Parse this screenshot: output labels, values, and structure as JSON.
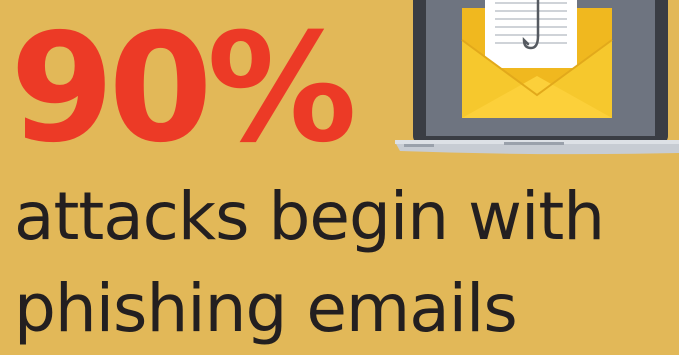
{
  "headline": {
    "stat": "90%",
    "line1": "attacks begin with",
    "line2": "phishing emails"
  },
  "illustration": {
    "icon": "laptop-phishing-email-icon",
    "parts": [
      "laptop-icon",
      "envelope-icon",
      "fishing-hook-icon"
    ]
  },
  "colors": {
    "background": "#e2b858",
    "stat": "#ec3a26",
    "caption": "#231f20",
    "envelope": "#f6c82d",
    "laptop_frame": "#3a3d44",
    "laptop_screen": "#6e7480",
    "laptop_base": "#c7ccd3"
  }
}
